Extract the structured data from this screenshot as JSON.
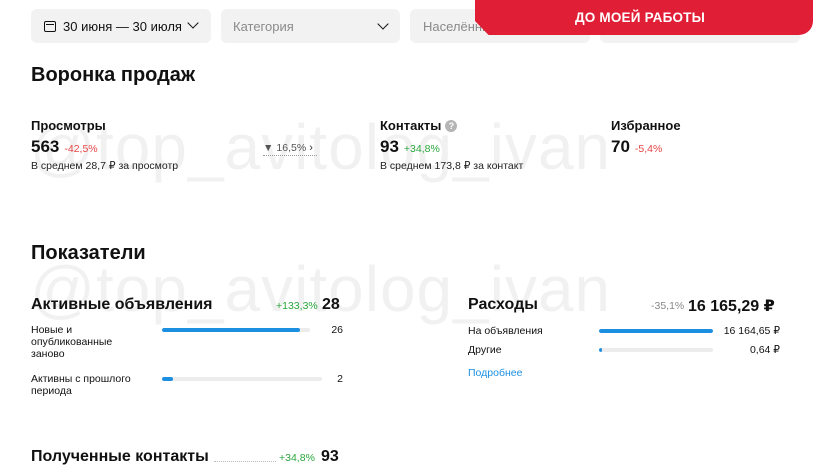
{
  "filters": {
    "date": "30 июня — 30 июля",
    "category_placeholder": "Категория",
    "city_placeholder": "Населённый пункт"
  },
  "banner": {
    "label": "ДО МОЕЙ РАБОТЫ"
  },
  "watermark": "@top_avitolog_ivan",
  "funnel": {
    "title": "Воронка продаж",
    "views": {
      "label": "Просмотры",
      "value": "563",
      "delta": "-42,5%",
      "sub": "В среднем 28,7 ₽ за просмотр"
    },
    "conversion": {
      "value": "16,5%"
    },
    "contacts": {
      "label": "Контакты",
      "value": "93",
      "delta": "+34,8%",
      "sub": "В среднем 173,8 ₽ за контакт"
    },
    "favorites": {
      "label": "Избранное",
      "value": "70",
      "delta": "-5,4%"
    }
  },
  "indicators": {
    "title": "Показатели",
    "active": {
      "title": "Активные объявления",
      "delta": "+133,3%",
      "total": "28",
      "rows": [
        {
          "label": "Новые и опубликованные заново",
          "value": "26",
          "fill": 0.93
        },
        {
          "label": "Активны с прошлого периода",
          "value": "2",
          "fill": 0.07
        }
      ]
    },
    "expenses": {
      "title": "Расходы",
      "delta": "-35,1%",
      "total": "16 165,29 ₽",
      "rows": [
        {
          "label": "На объявления",
          "value": "16 164,65 ₽",
          "fill": 0.9999
        },
        {
          "label": "Другие",
          "value": "0,64 ₽",
          "fill": 0.0001
        }
      ],
      "more_link": "Подробнее"
    },
    "contacts_received": {
      "title": "Полученные контакты",
      "delta": "+34,8%",
      "total": "93"
    }
  },
  "colors": {
    "accent": "#1d8fe1",
    "banner": "#e01e35",
    "negative": "#e64545",
    "positive": "#29a63c"
  }
}
